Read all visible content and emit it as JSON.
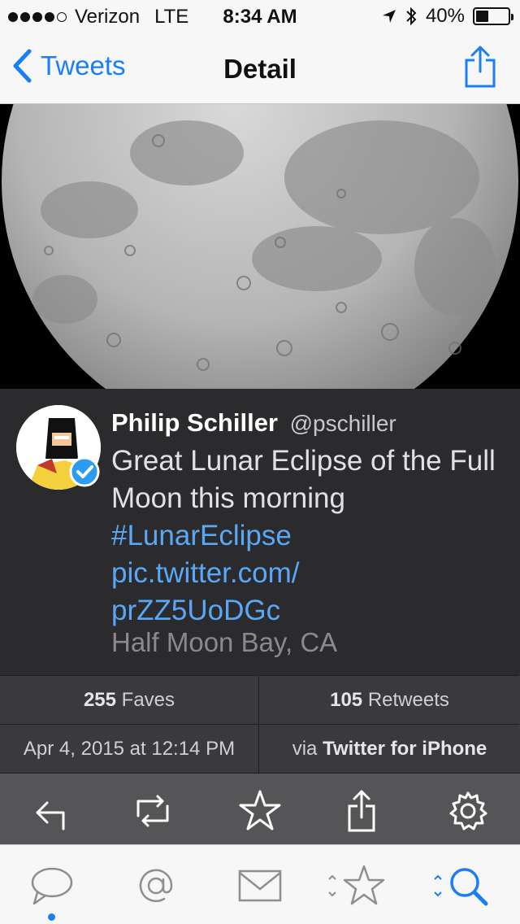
{
  "status_bar": {
    "carrier": "Verizon",
    "network": "LTE",
    "time": "8:34 AM",
    "battery_percent": "40%",
    "battery_level": 0.4,
    "signal_bars": 4
  },
  "nav": {
    "back_label": "Tweets",
    "title": "Detail",
    "icons": [
      "chevron-left-icon",
      "share-icon"
    ]
  },
  "tweet": {
    "author_name": "Philip Schiller",
    "handle": "@pschiller",
    "text": "Great Lunar Eclipse of the Full Moon this morning",
    "hashtag": "#LunarEclipse",
    "link_line1": "pic.twitter.com/",
    "link_line2": "prZZ5UoDGc",
    "location": "Half Moon Bay, CA",
    "verified": true
  },
  "stats": {
    "faves_count": "255",
    "faves_label": "Faves",
    "retweets_count": "105",
    "retweets_label": "Retweets",
    "timestamp": "Apr 4, 2015 at 12:14 PM",
    "via_prefix": "via",
    "client": "Twitter for iPhone"
  },
  "actions": [
    "reply-icon",
    "retweet-icon",
    "favorite-icon",
    "share-icon",
    "settings-icon"
  ],
  "tabbar": {
    "tabs": [
      "timeline-icon",
      "mentions-icon",
      "messages-icon",
      "favorites-icon",
      "search-icon"
    ],
    "active_tab": "search-icon",
    "unread_tab": "timeline-icon"
  },
  "colors": {
    "accent": "#1a7ef5",
    "link": "#5aa8f5",
    "tweet_bg": "#2b2b2d",
    "toolbar_bg": "#555557"
  }
}
